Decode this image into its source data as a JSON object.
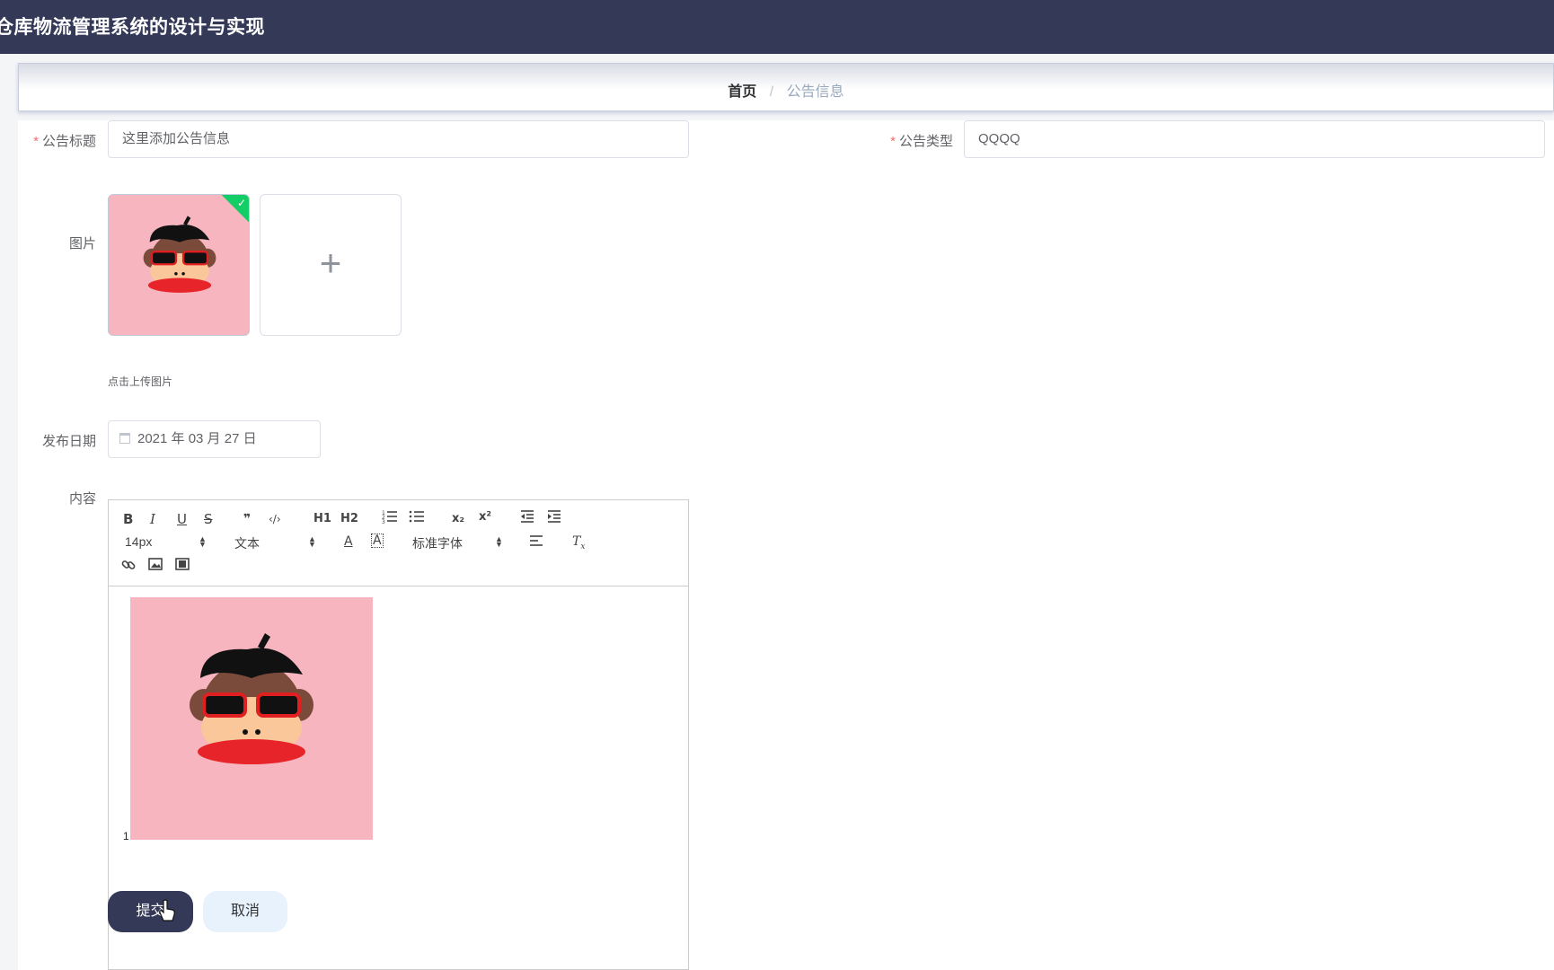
{
  "app": {
    "title": "仓库物流管理系统的设计与实现"
  },
  "breadcrumb": {
    "home": "首页",
    "separator": "/",
    "current": "公告信息"
  },
  "form": {
    "title": {
      "label": "公告标题",
      "value": "这里添加公告信息"
    },
    "type": {
      "label": "公告类型",
      "value": "QQQQ"
    },
    "picture": {
      "label": "图片",
      "hint": "点击上传图片",
      "add_icon": "+"
    },
    "date": {
      "label": "发布日期",
      "value": "2021 年 03 月 27 日"
    },
    "content": {
      "label": "内容",
      "text": "1"
    }
  },
  "editor": {
    "font_size": "14px",
    "header": "文本",
    "font_family": "标准字体",
    "buttons": {
      "bold": "B",
      "italic": "I",
      "underline": "U",
      "strike": "S",
      "quote": "❞",
      "code": "‹/›",
      "h1": "H1",
      "h2": "H2",
      "sub": "x₂",
      "sup": "x²"
    }
  },
  "actions": {
    "submit": "提交",
    "cancel": "取消"
  }
}
